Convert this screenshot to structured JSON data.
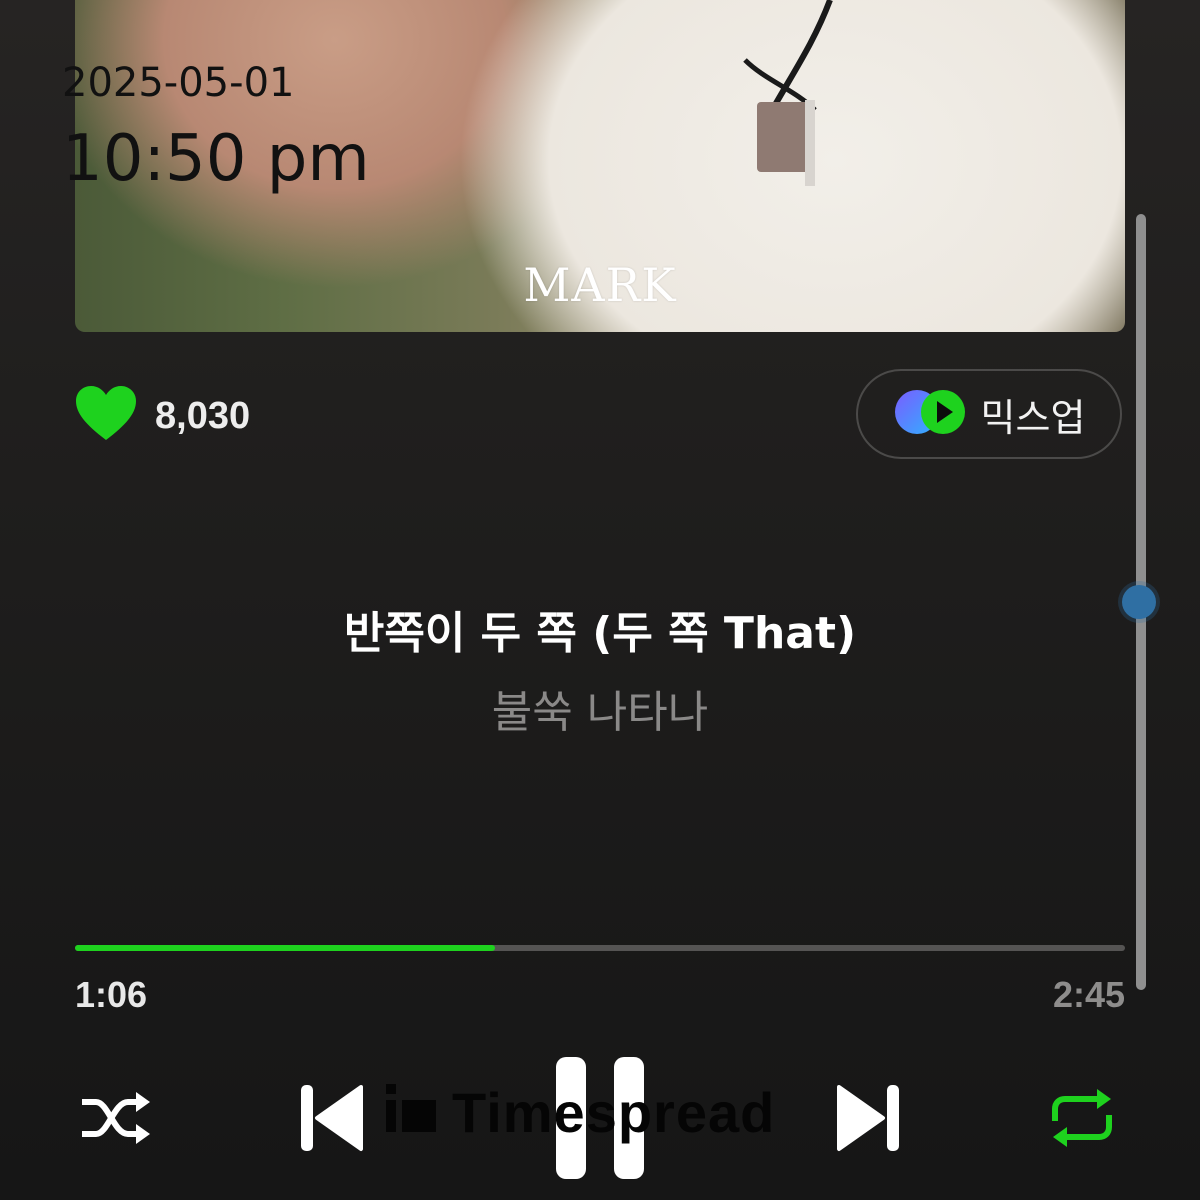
{
  "album": {
    "artwork_text": "MARK"
  },
  "overlay": {
    "date": "2025-05-01",
    "time": "10:50 pm"
  },
  "like": {
    "count": "8,030",
    "icon": "heart-icon",
    "color": "#1ed21e"
  },
  "mixup": {
    "label": "믹스업",
    "icon": "mixup-icon"
  },
  "lyrics": {
    "current": "반쪽이 두 쪽 (두 쪽 That)",
    "next": "불쑥 나타나"
  },
  "playback": {
    "elapsed": "1:06",
    "total": "2:45",
    "progress_fraction": 0.4,
    "accent_color": "#1ed21e"
  },
  "controls": {
    "shuffle_icon": "shuffle-icon",
    "previous_icon": "skip-previous-icon",
    "pause_icon": "pause-icon",
    "next_icon": "skip-next-icon",
    "repeat_icon": "repeat-icon",
    "repeat_active": true
  },
  "watermark": {
    "text": "Timespread"
  }
}
